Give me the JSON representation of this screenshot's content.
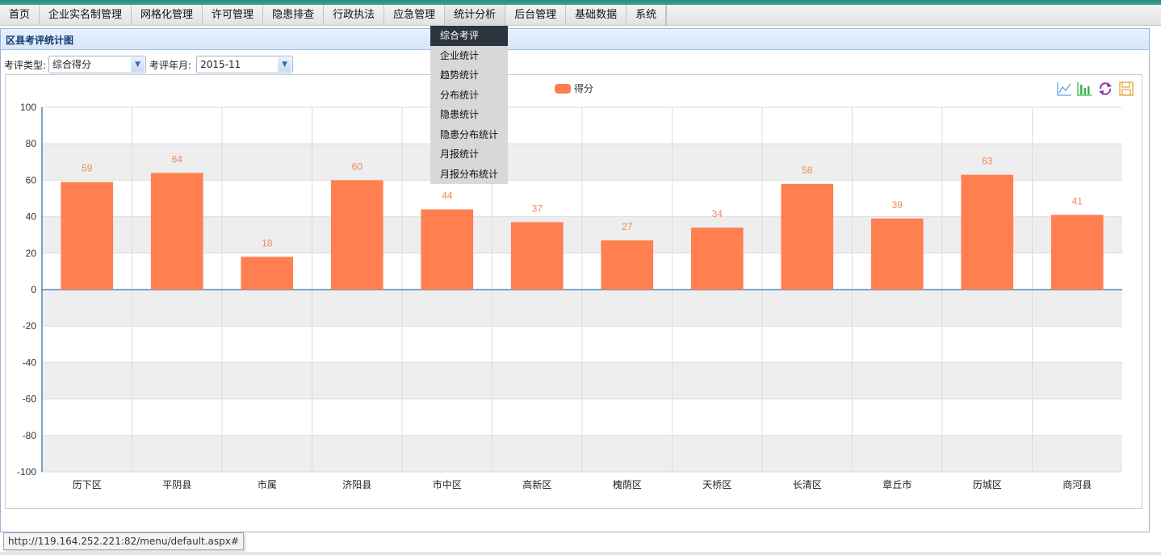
{
  "menu": {
    "items": [
      "首页",
      "企业实名制管理",
      "网格化管理",
      "许可管理",
      "隐患排查",
      "行政执法",
      "应急管理",
      "统计分析",
      "后台管理",
      "基础数据",
      "系统"
    ],
    "active_index": 7
  },
  "dropdown": {
    "items": [
      "综合考评",
      "企业统计",
      "趋势统计",
      "分布统计",
      "隐患统计",
      "隐患分布统计",
      "月报统计",
      "月报分布统计"
    ],
    "selected_index": 0
  },
  "panel": {
    "title": "区县考评统计图"
  },
  "filters": {
    "type_label": "考评类型:",
    "type_value": "综合得分",
    "month_label": "考评年月:",
    "month_value": "2015-11"
  },
  "toolbar": {
    "icons": [
      "line-chart-icon",
      "bar-chart-icon",
      "refresh-icon",
      "save-icon"
    ]
  },
  "chart_data": {
    "type": "bar",
    "categories": [
      "历下区",
      "平阴县",
      "市属",
      "济阳县",
      "市中区",
      "高新区",
      "槐荫区",
      "天桥区",
      "长清区",
      "章丘市",
      "历城区",
      "商河县"
    ],
    "series": [
      {
        "name": "得分",
        "values": [
          59,
          64,
          18,
          60,
          44,
          37,
          27,
          34,
          58,
          39,
          63,
          41
        ]
      }
    ],
    "ylim": [
      -100,
      100
    ],
    "yticks": [
      100,
      80,
      60,
      40,
      20,
      0,
      -20,
      -40,
      -60,
      -80,
      -100
    ],
    "bar_color": "#ff7f50",
    "label_color": "#f08860",
    "grid": true,
    "legend_position": "top-center"
  },
  "status_bar": {
    "url": "http://119.164.252.221:82/menu/default.aspx#"
  }
}
